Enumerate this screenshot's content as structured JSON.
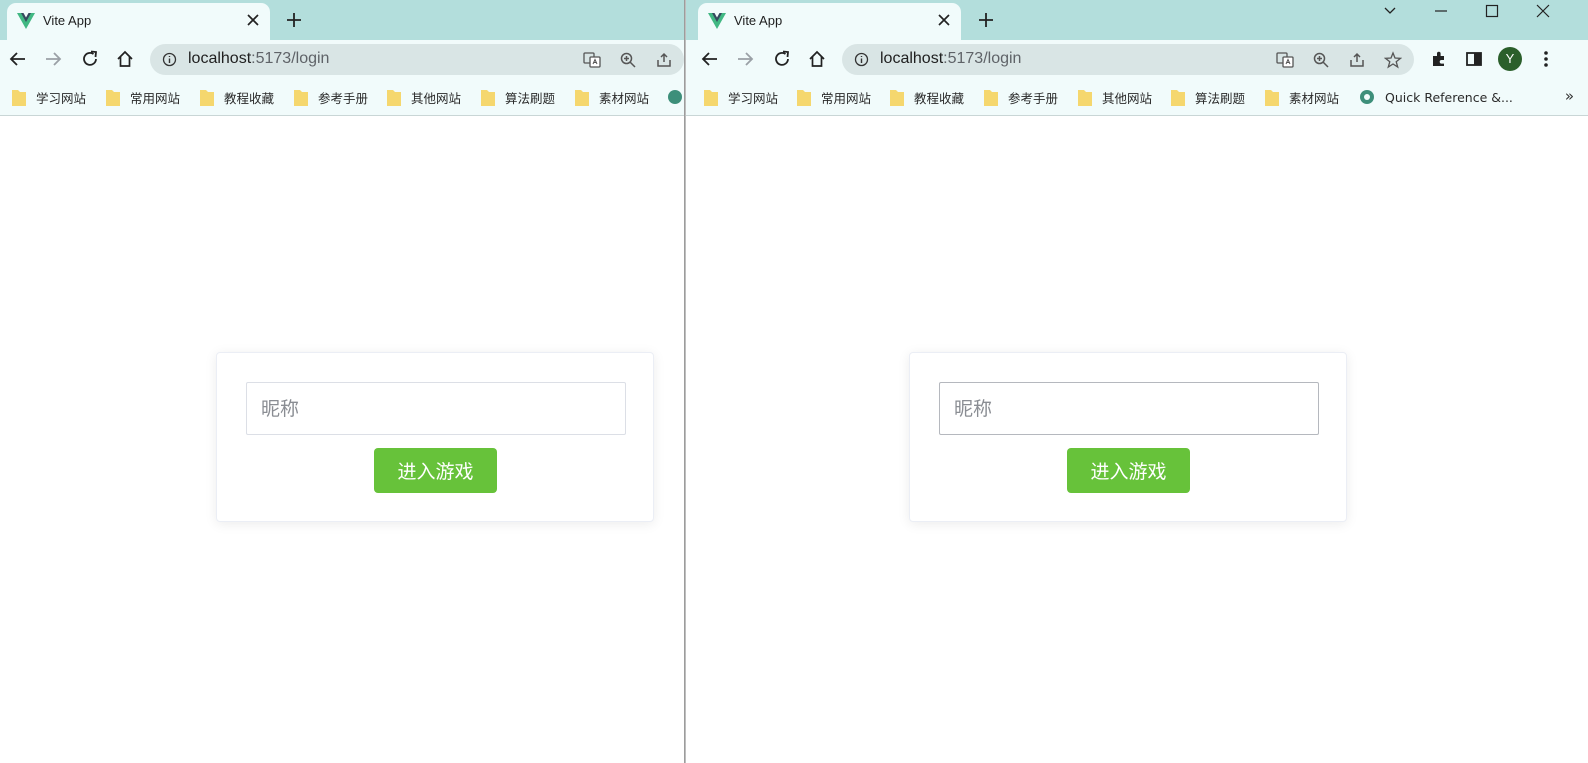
{
  "windows": [
    {
      "id": "left",
      "tab": {
        "title": "Vite App"
      },
      "omnibox": {
        "host": "localhost",
        "path": ":5173/login"
      },
      "bookmarks": [
        "学习网站",
        "常用网站",
        "教程收藏",
        "参考手册",
        "其他网站",
        "算法刷题",
        "素材网站"
      ],
      "page": {
        "nickname_placeholder": "昵称",
        "enter_button": "进入游戏"
      }
    },
    {
      "id": "right",
      "tab": {
        "title": "Vite App"
      },
      "omnibox": {
        "host": "localhost",
        "path": ":5173/login"
      },
      "bookmarks": [
        "学习网站",
        "常用网站",
        "教程收藏",
        "参考手册",
        "其他网站",
        "算法刷题",
        "素材网站",
        "Quick Reference &..."
      ],
      "bookmarks_overflow": "»",
      "profile_initial": "Y",
      "page": {
        "nickname_placeholder": "昵称",
        "enter_button": "进入游戏"
      }
    }
  ],
  "colors": {
    "primary_button": "#67c23a",
    "tabstrip": "#b3dedc",
    "toolbar": "#f1fbfb",
    "profile": "#2b5f2b"
  },
  "icons": [
    "vue-logo-icon",
    "close-icon",
    "plus-icon",
    "back-arrow-icon",
    "forward-arrow-icon",
    "reload-icon",
    "home-icon",
    "info-icon",
    "translate-icon",
    "zoom-icon",
    "share-icon",
    "star-icon",
    "extensions-icon",
    "side-panel-icon",
    "kebab-menu-icon",
    "folder-icon",
    "chevron-down-icon",
    "minimize-icon",
    "maximize-icon"
  ]
}
